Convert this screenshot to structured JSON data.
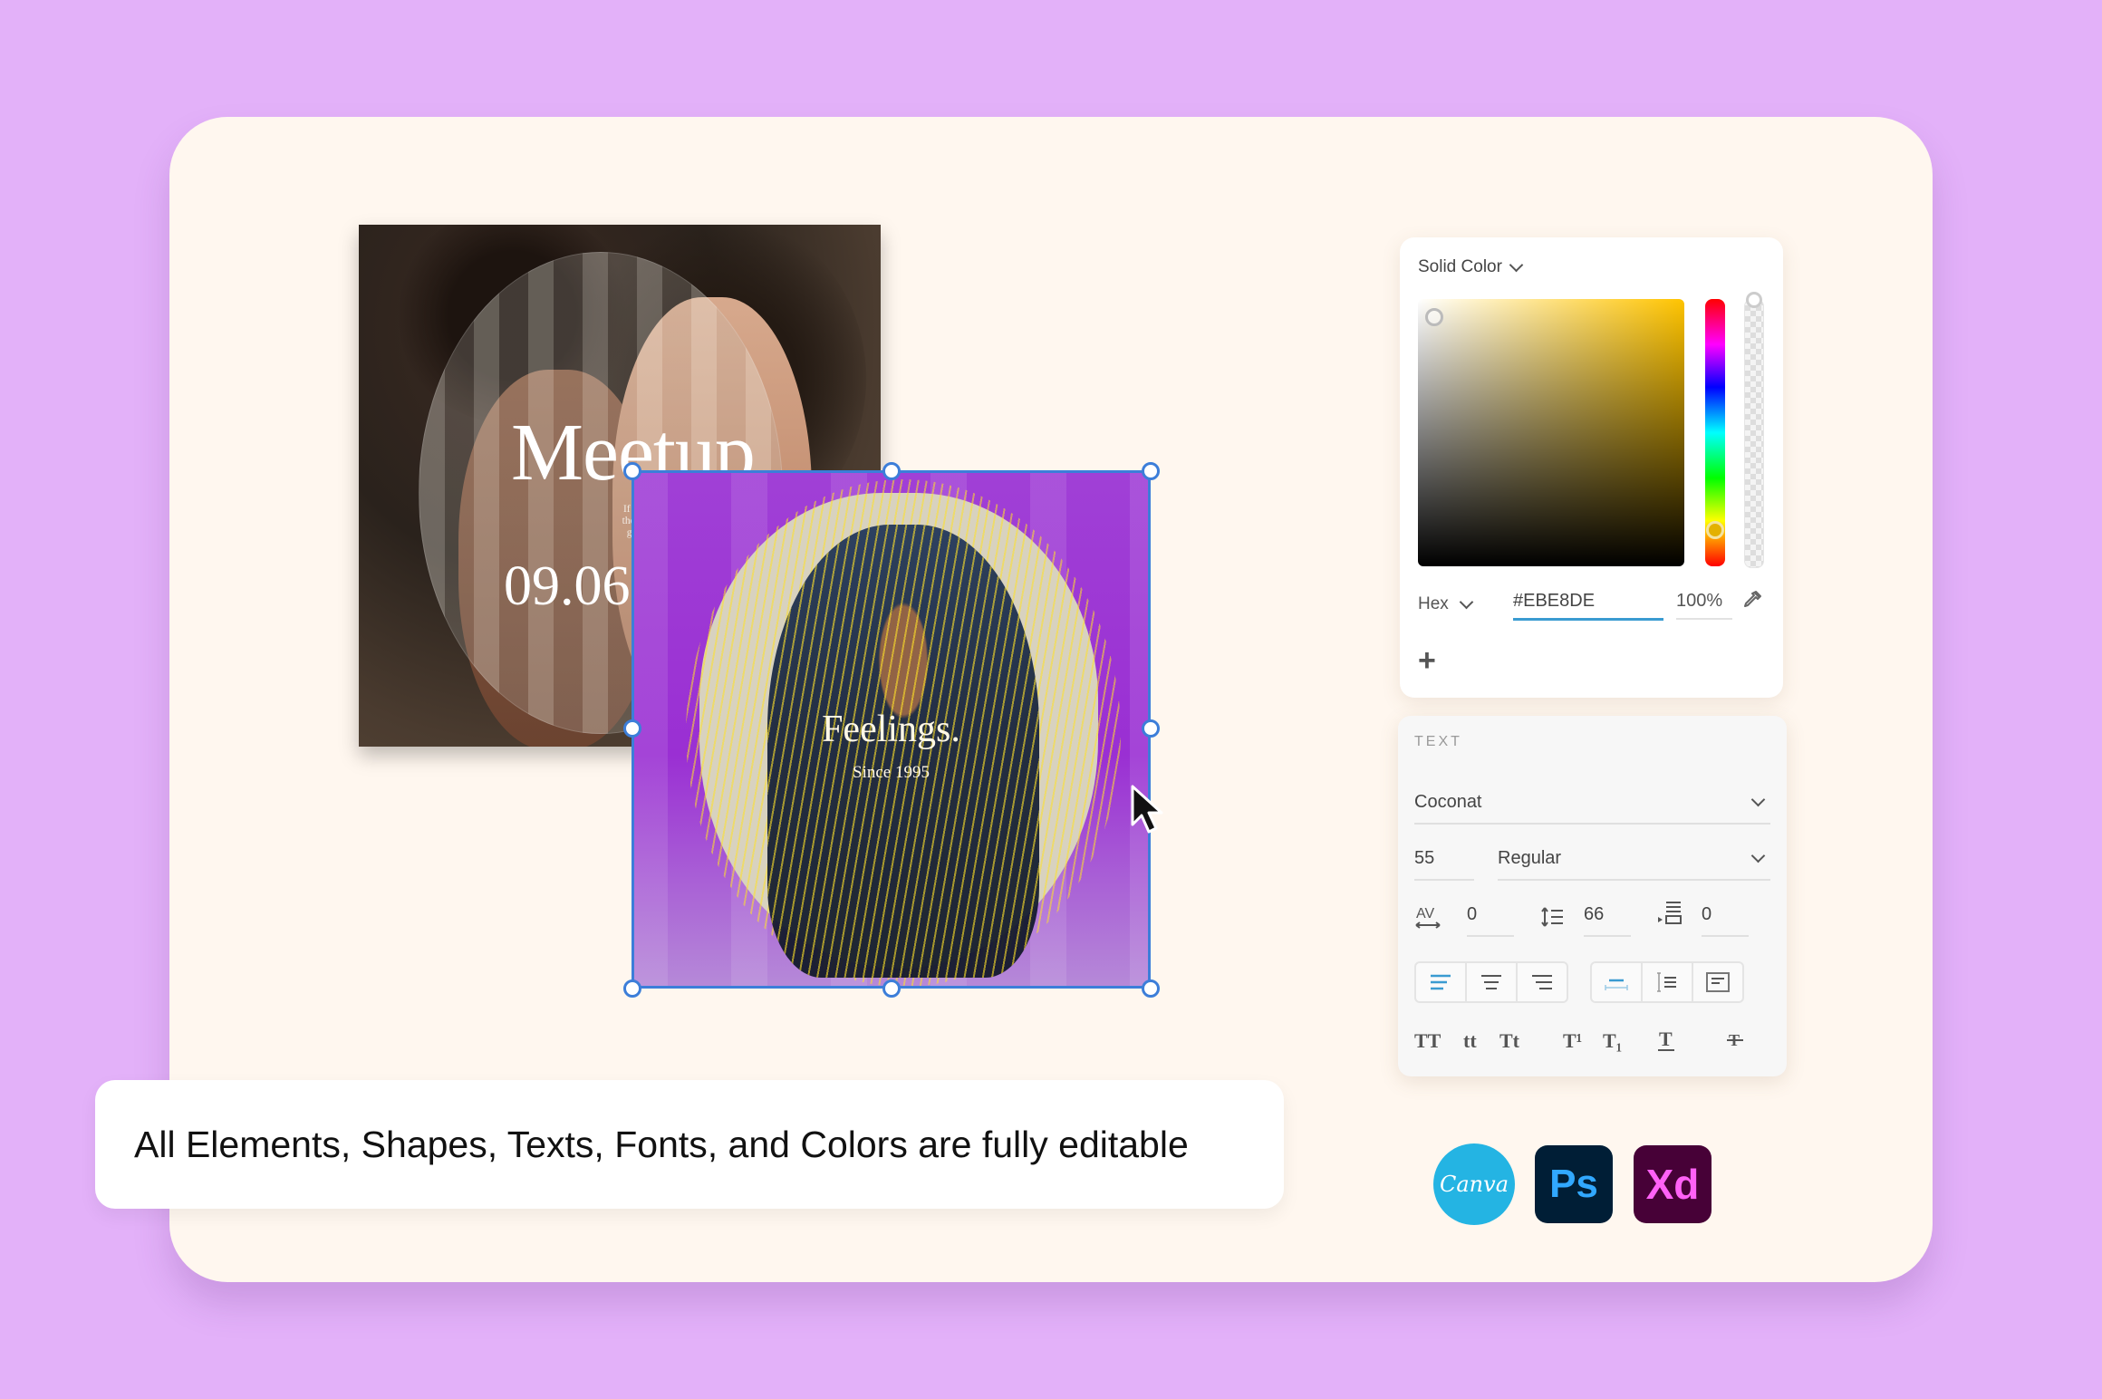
{
  "caption": "All Elements, Shapes, Texts, Fonts, and Colors are fully editable",
  "canvas": {
    "meetup_poster": {
      "title": "Meetup",
      "blurb": "If a warrior is to succ\nthe success must com\ngreat deal of effort b\nor obsess",
      "date": "09.06."
    },
    "feelings_poster": {
      "title": "Feelings.",
      "subtitle": "Since 1995",
      "selected": true
    }
  },
  "color_picker": {
    "mode_label": "Solid Color",
    "format_label": "Hex",
    "hex_value": "#EBE8DE",
    "opacity_value": "100%",
    "add_label": "+",
    "hue_color": "#FFC400"
  },
  "text_panel": {
    "header": "TEXT",
    "font_family": "Coconat",
    "font_size": "55",
    "font_style": "Regular",
    "tracking": "0",
    "line_height": "66",
    "paragraph_spacing": "0",
    "align_options": [
      "left",
      "center",
      "right"
    ],
    "align_selected": "left",
    "sizing_options": [
      "auto-width",
      "auto-height",
      "fixed"
    ],
    "sizing_selected": "auto-width",
    "case_options": [
      "TT",
      "tt",
      "Tt"
    ],
    "script_options": [
      "T¹",
      "T₁"
    ],
    "decoration_options": [
      "underline",
      "strikethrough"
    ]
  },
  "apps": [
    {
      "name": "Canva",
      "label": "Canva",
      "color": "#24B4E3"
    },
    {
      "name": "Photoshop",
      "label": "Ps",
      "color": "#31A8FF"
    },
    {
      "name": "Adobe XD",
      "label": "Xd",
      "color": "#FF61F6"
    }
  ],
  "colors": {
    "background": "#E3B1F9",
    "card": "#FFF7EF",
    "selection": "#3C7ED9",
    "accent_input": "#3A9BD1"
  }
}
